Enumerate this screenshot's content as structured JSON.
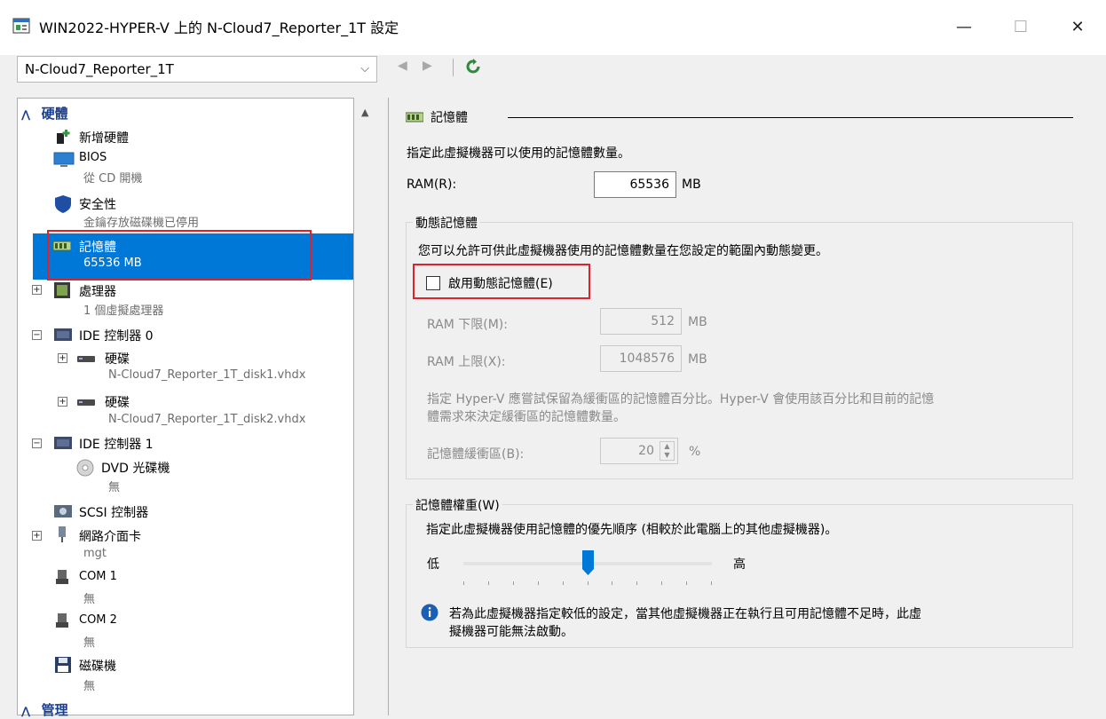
{
  "window": {
    "title": "WIN2022-HYPER-V 上的 N-Cloud7_Reporter_1T 設定",
    "minimize": "—",
    "maximize": "☐",
    "close": "✕"
  },
  "toolbar": {
    "vm_selected": "N-Cloud7_Reporter_1T",
    "back_glyph": "◀",
    "forward_glyph": "▶"
  },
  "tree": {
    "hardware_header": "硬體",
    "add_hardware": "新增硬體",
    "bios": "BIOS",
    "bios_sub": "從 CD 開機",
    "security": "安全性",
    "security_sub": "金鑰存放磁碟機已停用",
    "memory": "記憶體",
    "memory_sub": "65536 MB",
    "processor": "處理器",
    "processor_sub": "1 個虛擬處理器",
    "ide0": "IDE 控制器 0",
    "disk1": "硬碟",
    "disk1_sub": "N-Cloud7_Reporter_1T_disk1.vhdx",
    "disk2": "硬碟",
    "disk2_sub": "N-Cloud7_Reporter_1T_disk2.vhdx",
    "ide1": "IDE 控制器 1",
    "dvd": "DVD 光碟機",
    "dvd_sub": "無",
    "scsi": "SCSI 控制器",
    "nic": "網路介面卡",
    "nic_sub": "mgt",
    "com1": "COM 1",
    "com1_sub": "無",
    "com2": "COM 2",
    "com2_sub": "無",
    "floppy": "磁碟機",
    "floppy_sub": "無",
    "management_header": "管理"
  },
  "memory_panel": {
    "heading": "記憶體",
    "description": "指定此虛擬機器可以使用的記憶體數量。",
    "ram_label": "RAM(R):",
    "ram_value": "65536",
    "ram_unit": "MB",
    "dynamic": {
      "title": "動態記憶體",
      "description": "您可以允許可供此虛擬機器使用的記憶體數量在您設定的範圍內動態變更。",
      "enable_label": "啟用動態記憶體(E)",
      "enabled": false,
      "min_label": "RAM 下限(M):",
      "min_value": "512",
      "max_label": "RAM 上限(X):",
      "max_value": "1048576",
      "unit": "MB",
      "buffer_desc_line1": "指定 Hyper-V 應嘗試保留為緩衝區的記憶體百分比。Hyper-V 會使用該百分比和目前的記憶",
      "buffer_desc_line2": "體需求來決定緩衝區的記憶體數量。",
      "buffer_label": "記憶體緩衝區(B):",
      "buffer_value": "20",
      "buffer_unit": "%"
    },
    "weight": {
      "title": "記憶體權重(W)",
      "description": "指定此虛擬機器使用記憶體的優先順序 (相較於此電腦上的其他虛擬機器)。",
      "low": "低",
      "high": "高",
      "level_fraction": 0.5,
      "info_line1": "若為此虛擬機器指定較低的設定，當其他虛擬機器正在執行且可用記憶體不足時，此虛",
      "info_line2": "擬機器可能無法啟動。"
    }
  },
  "colors": {
    "selection": "#0078d7",
    "highlight_box": "#e0202b",
    "accent": "#1a3f8e"
  }
}
